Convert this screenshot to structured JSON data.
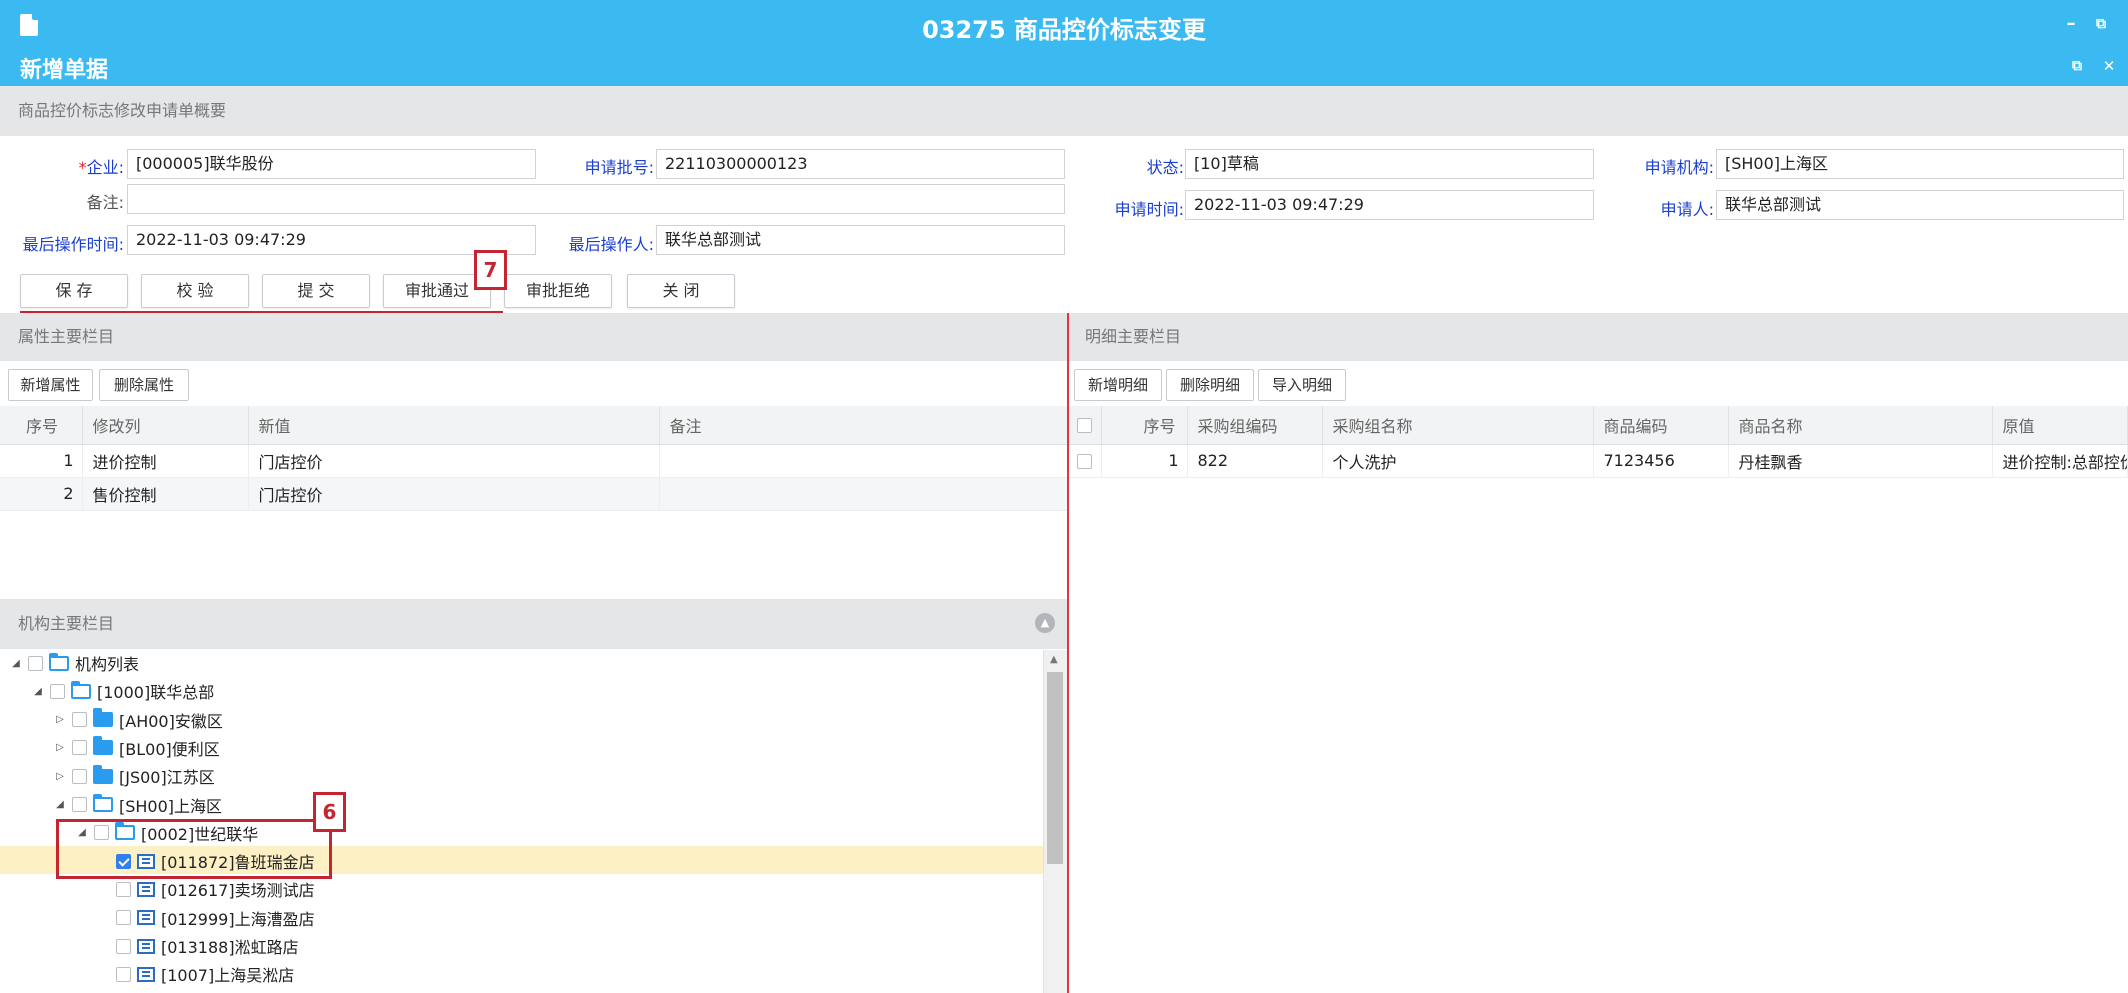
{
  "window": {
    "title": "03275 商品控价标志变更",
    "subtitle": "新增单据",
    "minimize_glyph": "–",
    "restore_glyph": "⧉",
    "close_glyph": "✕"
  },
  "summary": {
    "header": "商品控价标志修改申请单概要",
    "fields": {
      "enterprise_label": "企业:",
      "enterprise_required": "*",
      "enterprise_value": "[000005]联华股份",
      "batch_label": "申请批号:",
      "batch_value": "22110300000123",
      "status_label": "状态:",
      "status_value": "[10]草稿",
      "org_label": "申请机构:",
      "org_value": "[SH00]上海区",
      "remark_label": "备注:",
      "remark_value": "",
      "apply_time_label": "申请时间:",
      "apply_time_value": "2022-11-03 09:47:29",
      "applicant_label": "申请人:",
      "applicant_value": "联华总部测试",
      "last_op_time_label": "最后操作时间:",
      "last_op_time_value": "2022-11-03 09:47:29",
      "last_operator_label": "最后操作人:",
      "last_operator_value": "联华总部测试"
    },
    "buttons": [
      "保 存",
      "校 验",
      "提 交",
      "审批通过",
      "审批拒绝",
      "关 闭"
    ]
  },
  "attributes": {
    "header": "属性主要栏目",
    "toolbar": [
      "新增属性",
      "删除属性"
    ],
    "columns": [
      "序号",
      "修改列",
      "新值",
      "备注"
    ],
    "rows": [
      {
        "no": "1",
        "col": "进价控制",
        "new": "门店控价",
        "remark": ""
      },
      {
        "no": "2",
        "col": "售价控制",
        "new": "门店控价",
        "remark": ""
      }
    ]
  },
  "details": {
    "header": "明细主要栏目",
    "toolbar": [
      "新增明细",
      "删除明细",
      "导入明细"
    ],
    "columns": [
      "序号",
      "采购组编码",
      "采购组名称",
      "商品编码",
      "商品名称",
      "原值"
    ],
    "rows": [
      {
        "no": "1",
        "group_code": "822",
        "group_name": "个人洗护",
        "sku": "7123456",
        "name": "丹桂飘香",
        "orig": "进价控制:总部控价，售"
      }
    ]
  },
  "org_tree": {
    "header": "机构主要栏目",
    "nodes": [
      {
        "label": "机构列表",
        "level": 0,
        "type": "folder-open",
        "arrow": "◢",
        "checked": false
      },
      {
        "label": "[1000]联华总部",
        "level": 1,
        "type": "folder-open",
        "arrow": "◢",
        "checked": false
      },
      {
        "label": "[AH00]安徽区",
        "level": 2,
        "type": "folder",
        "arrow": "▷",
        "checked": false
      },
      {
        "label": "[BL00]便利区",
        "level": 2,
        "type": "folder",
        "arrow": "▷",
        "checked": false
      },
      {
        "label": "[JS00]江苏区",
        "level": 2,
        "type": "folder",
        "arrow": "▷",
        "checked": false
      },
      {
        "label": "[SH00]上海区",
        "level": 2,
        "type": "folder-open",
        "arrow": "◢",
        "checked": false
      },
      {
        "label": "[0002]世纪联华",
        "level": 3,
        "type": "folder-open",
        "arrow": "◢",
        "checked": false
      },
      {
        "label": "[011872]鲁班瑞金店",
        "level": 4,
        "type": "store",
        "arrow": "",
        "checked": true
      },
      {
        "label": "[012617]卖场测试店",
        "level": 4,
        "type": "store",
        "arrow": "",
        "checked": false
      },
      {
        "label": "[012999]上海漕盈店",
        "level": 4,
        "type": "store",
        "arrow": "",
        "checked": false
      },
      {
        "label": "[013188]淞虹路店",
        "level": 4,
        "type": "store",
        "arrow": "",
        "checked": false
      },
      {
        "label": "[1007]上海吴淞店",
        "level": 4,
        "type": "store",
        "arrow": "",
        "checked": false
      }
    ]
  },
  "annotations": {
    "badge_7": "7",
    "badge_6": "6"
  },
  "colors": {
    "titlebar": "#3bbaf2",
    "label_blue": "#1a3fd0",
    "annotation_red": "#c32630",
    "selected_row": "#fdf0c4"
  }
}
